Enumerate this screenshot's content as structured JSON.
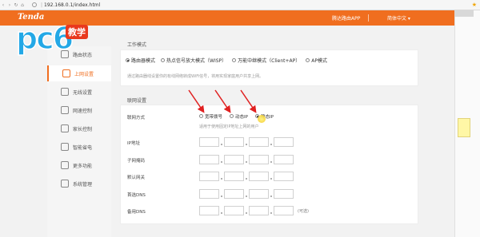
{
  "browser": {
    "url": "192.168.0.1/index.html"
  },
  "header": {
    "brand": "Tenda",
    "app_link": "腾达路由APP",
    "language": "简体中文"
  },
  "watermark": {
    "logo": "pc6",
    "tag": "教学"
  },
  "sidebar": {
    "items": [
      {
        "label": "路由状态",
        "icon": "status-icon",
        "active": false
      },
      {
        "label": "上网设置",
        "icon": "internet-icon",
        "active": true
      },
      {
        "label": "无线设置",
        "icon": "wifi-icon",
        "active": false
      },
      {
        "label": "网速控制",
        "icon": "speed-icon",
        "active": false
      },
      {
        "label": "家长控制",
        "icon": "parental-icon",
        "active": false
      },
      {
        "label": "智能省电",
        "icon": "power-icon",
        "active": false
      },
      {
        "label": "更多功能",
        "icon": "more-icon",
        "active": false
      },
      {
        "label": "系统管理",
        "icon": "system-icon",
        "active": false
      }
    ]
  },
  "work_mode": {
    "title": "工作模式",
    "options": [
      {
        "label": "路由器模式",
        "selected": true
      },
      {
        "label": "热点信号放大模式（WISP）",
        "selected": false
      },
      {
        "label": "万能中继模式（Client+AP）",
        "selected": false
      },
      {
        "label": "AP模式",
        "selected": false
      }
    ],
    "note": "通过路由器线设置你的有线网络转成WiFi信号，将用实现家庭用户共享上网。"
  },
  "internet": {
    "title": "联网设置",
    "connection_label": "联网方式",
    "connection_options": [
      {
        "label": "宽带拨号",
        "selected": false
      },
      {
        "label": "动态IP",
        "selected": false
      },
      {
        "label": "静态IP",
        "selected": true
      }
    ],
    "hint": "适用于使用固定IP地址上网的用户",
    "fields": [
      {
        "label": "IP地址",
        "optional": ""
      },
      {
        "label": "子网掩码",
        "optional": ""
      },
      {
        "label": "默认网关",
        "optional": ""
      },
      {
        "label": "首选DNS",
        "optional": ""
      },
      {
        "label": "备用DNS",
        "optional": "(可选)"
      }
    ]
  },
  "colors": {
    "accent": "#f06e1f",
    "arrow": "#e02020"
  }
}
